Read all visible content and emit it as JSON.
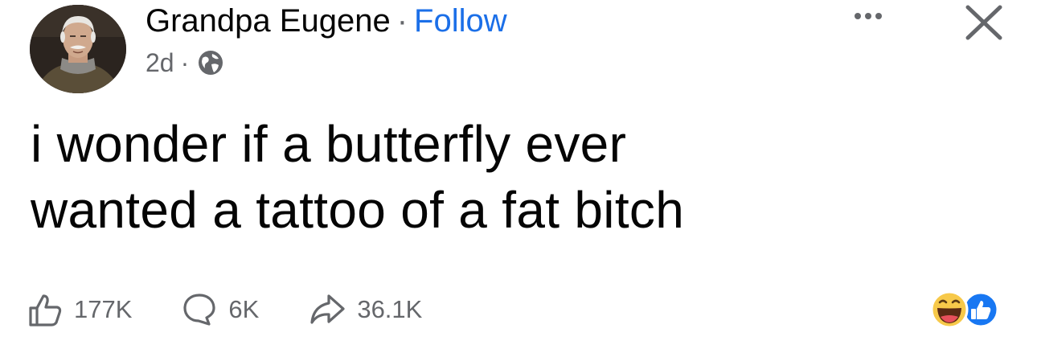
{
  "author": {
    "name": "Grandpa Eugene",
    "separator": "·",
    "follow_label": "Follow",
    "avatar_icon": "profile-photo"
  },
  "meta": {
    "time": "2d",
    "separator": "·",
    "audience_icon": "globe-icon"
  },
  "header_actions": {
    "more_icon": "ellipsis-icon",
    "close_icon": "close-icon"
  },
  "post": {
    "line1": "i wonder if a butterfly ever",
    "line2": "wanted a tattoo of a fat bitch"
  },
  "actions": {
    "like_count": "177K",
    "comment_count": "6K",
    "share_count": "36.1K"
  },
  "reactions": {
    "icons": [
      "haha-reaction-icon",
      "like-reaction-icon"
    ]
  },
  "colors": {
    "follow": "#1b6fe8",
    "secondary_text": "#65676b",
    "like_badge": "#1877f2",
    "haha_badge": "#f7c94a"
  }
}
